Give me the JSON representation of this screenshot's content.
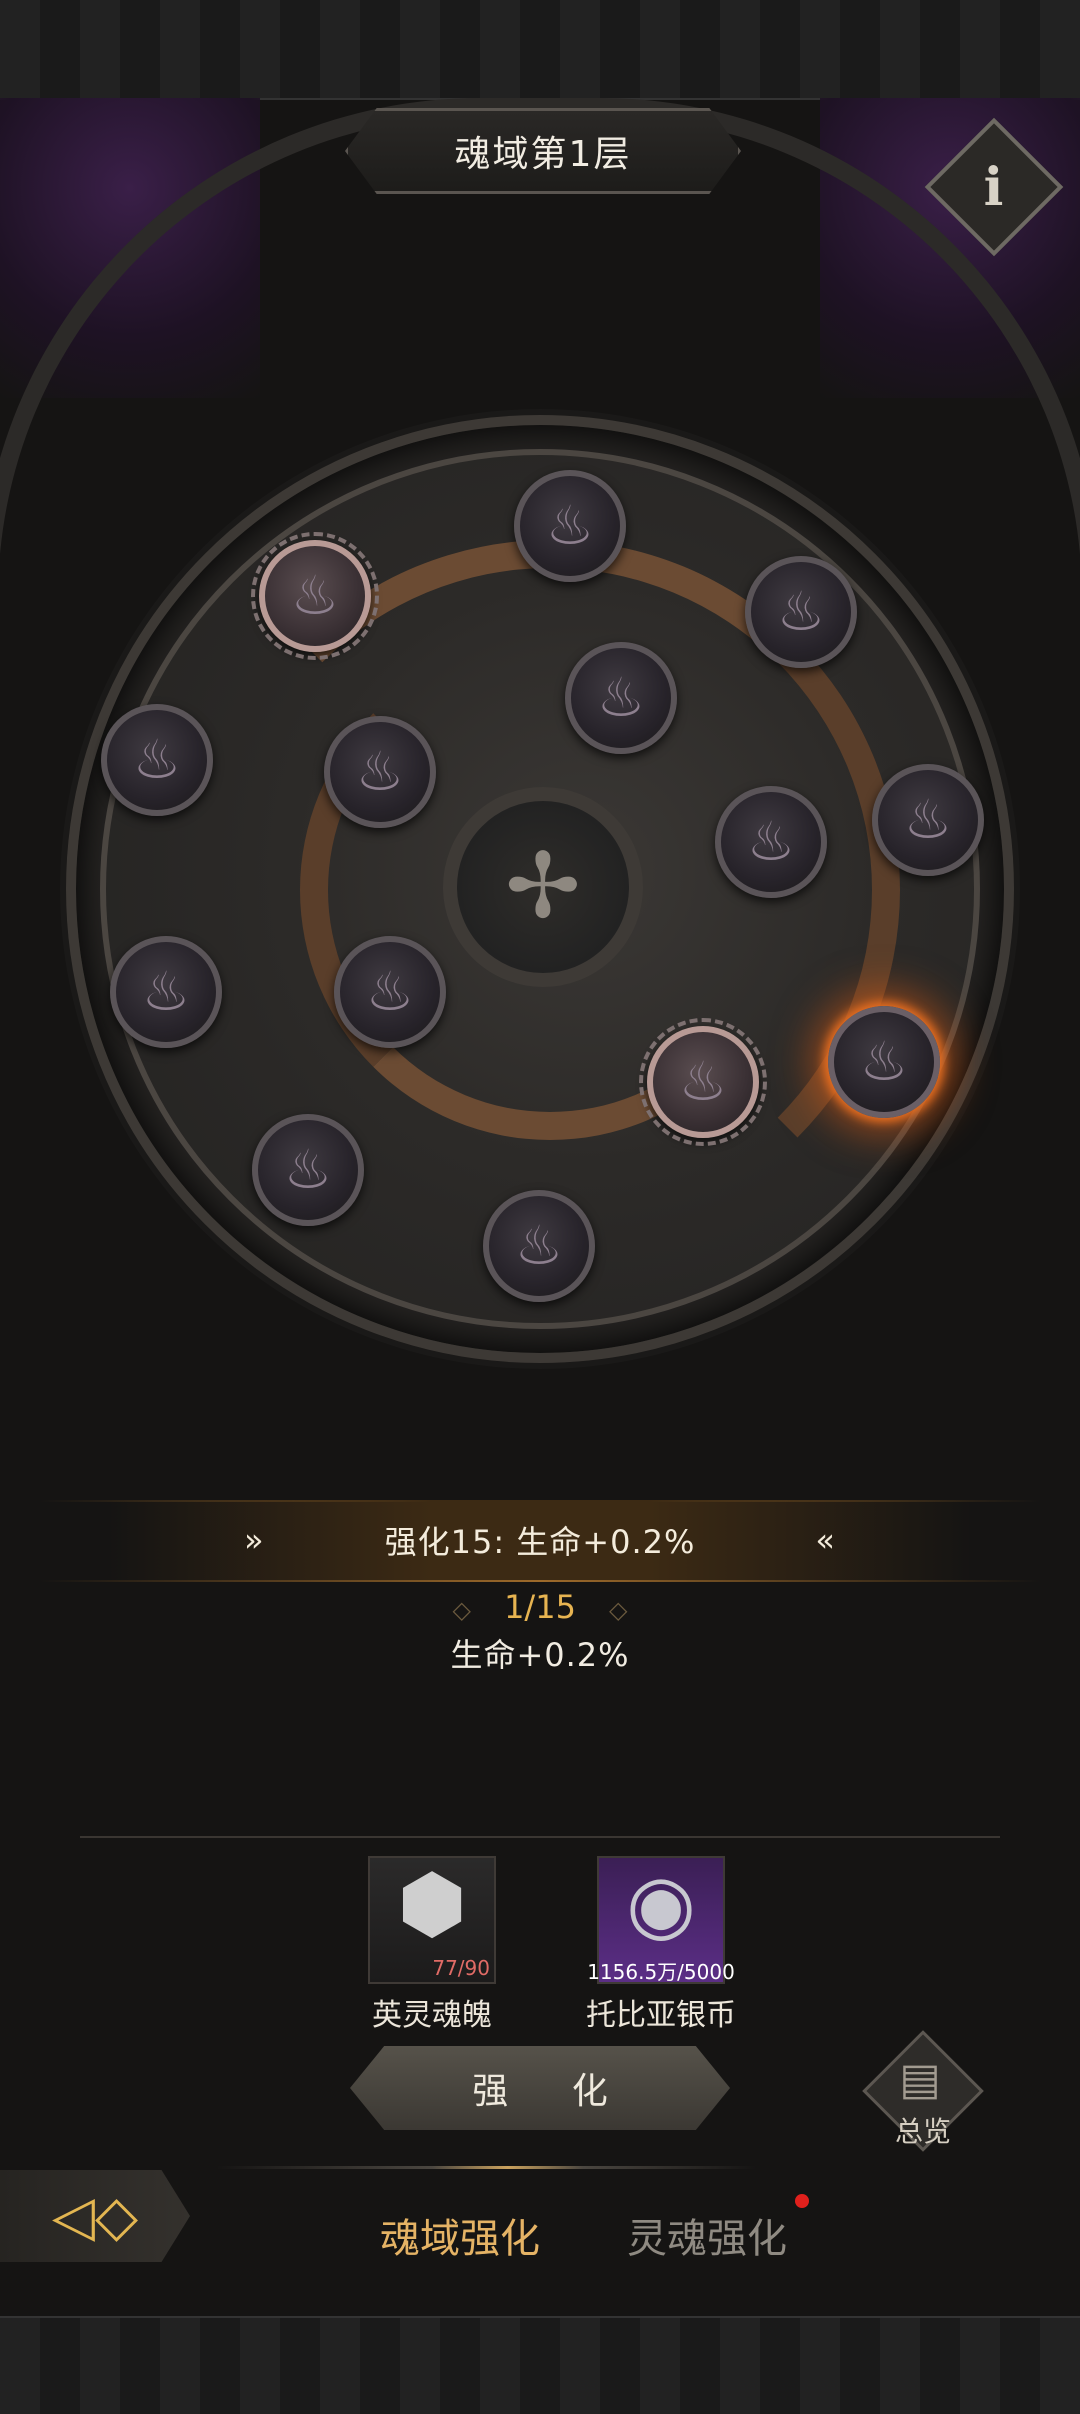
{
  "header": {
    "title": "魂域第1层",
    "info_icon": "info-icon"
  },
  "wheel": {
    "center_icon": "pinwheel-rune-icon",
    "node_icon": "soul-flame-icon",
    "total_nodes": 15
  },
  "stats": {
    "current_level_text": "强化15: 生命+0.2%",
    "progress": "1/15",
    "effect": "生命+0.2%"
  },
  "resources": [
    {
      "name": "英灵魂魄",
      "count": "77/90",
      "count_color": "#e06b66",
      "icon": "soul-crystal-icon"
    },
    {
      "name": "托比亚银币",
      "count": "1156.5万/5000",
      "count_color": "#ffffff",
      "icon": "silver-coin-icon"
    }
  ],
  "actions": {
    "strengthen": "强 化",
    "overview": "总览"
  },
  "tabs": [
    {
      "label": "魂域强化",
      "active": true
    },
    {
      "label": "灵魂强化",
      "active": false,
      "badge": true
    }
  ],
  "colors": {
    "accent_gold": "#e5b365",
    "glow_orange": "#f17c2a",
    "badge_red": "#e0201c"
  }
}
